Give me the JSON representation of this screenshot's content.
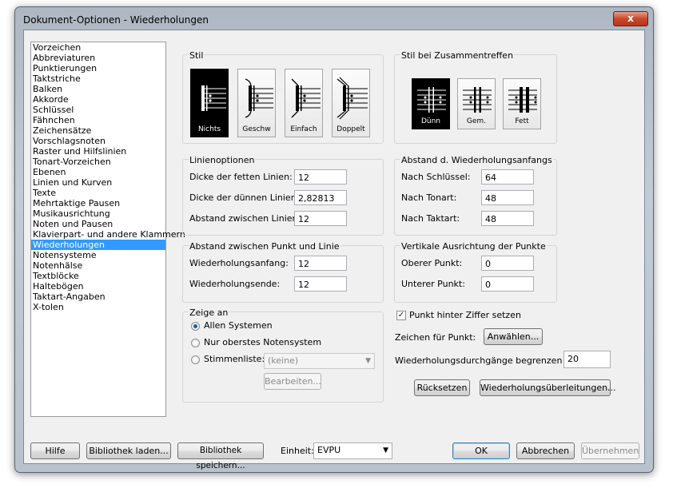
{
  "window": {
    "title": "Dokument-Optionen - Wiederholungen",
    "close_glyph": "x"
  },
  "sidebar": {
    "items": [
      "Vorzeichen",
      "Abbreviaturen",
      "Punktierungen",
      "Taktstriche",
      "Balken",
      "Akkorde",
      "Schlüssel",
      "Fähnchen",
      "Zeichensätze",
      "Vorschlagsnoten",
      "Raster und Hilfslinien",
      "Tonart-Vorzeichen",
      "Ebenen",
      "Linien und Kurven",
      "Texte",
      "Mehrtaktige Pausen",
      "Musikausrichtung",
      "Noten und Pausen",
      "Klavierpart- und andere Klammern",
      "Wiederholungen",
      "Notensysteme",
      "Notenhälse",
      "Textblöcke",
      "Haltebögen",
      "Taktart-Angaben",
      "X-tolen"
    ],
    "selected": "Wiederholungen"
  },
  "stil": {
    "label": "Stil",
    "options": [
      "Nichts",
      "Geschw",
      "Einfach",
      "Doppelt"
    ],
    "selected": "Nichts"
  },
  "zusammen": {
    "label": "Stil bei Zusammentreffen",
    "options": [
      "Dünn",
      "Gem.",
      "Fett"
    ],
    "selected": "Dünn"
  },
  "linien": {
    "label": "Linienoptionen",
    "fields": [
      {
        "label": "Dicke der fetten Linien:",
        "value": "12"
      },
      {
        "label": "Dicke der dünnen Linien:",
        "value": "2,82813"
      },
      {
        "label": "Abstand zwischen Linien:",
        "value": "12"
      }
    ]
  },
  "anfang": {
    "label": "Abstand d. Wiederholungsanfangs",
    "fields": [
      {
        "label": "Nach Schlüssel:",
        "value": "64"
      },
      {
        "label": "Nach Tonart:",
        "value": "48"
      },
      {
        "label": "Nach Taktart:",
        "value": "48"
      }
    ]
  },
  "punkt": {
    "label": "Abstand zwischen Punkt und Linie",
    "fields": [
      {
        "label": "Wiederholungsanfang:",
        "value": "12"
      },
      {
        "label": "Wiederholungsende:",
        "value": "12"
      }
    ]
  },
  "vertikal": {
    "label": "Vertikale Ausrichtung der Punkte",
    "fields": [
      {
        "label": "Oberer Punkt:",
        "value": "0"
      },
      {
        "label": "Unterer Punkt:",
        "value": "0"
      }
    ]
  },
  "zeige": {
    "label": "Zeige an",
    "options": [
      "Allen Systemen",
      "Nur oberstes Notensystem",
      "Stimmenliste:"
    ],
    "selected": "Allen Systemen",
    "combo_value": "(keine)",
    "edit_button": "Bearbeiten..."
  },
  "right": {
    "checkbox_label": "Punkt hinter Ziffer setzen",
    "checkbox_checked": true,
    "checkbox_glyph": "✓",
    "zeichen_label": "Zeichen für Punkt:",
    "anwaehlen": "Anwählen...",
    "begrenzen_label": "Wiederholungsdurchgänge begrenzen auf:",
    "begrenzen_value": "20",
    "ruecksetzen": "Rücksetzen",
    "ueberleitungen": "Wiederholungsüberleitungen..."
  },
  "bottom": {
    "hilfe": "Hilfe",
    "bib_laden": "Bibliothek laden...",
    "bib_speichern": "Bibliothek speichern...",
    "einheit_label": "Einheit:",
    "einheit_value": "EVPU",
    "ok": "OK",
    "abbrechen": "Abbrechen",
    "uebernehmen": "Übernehmen",
    "dropdown_glyph": "▼"
  }
}
